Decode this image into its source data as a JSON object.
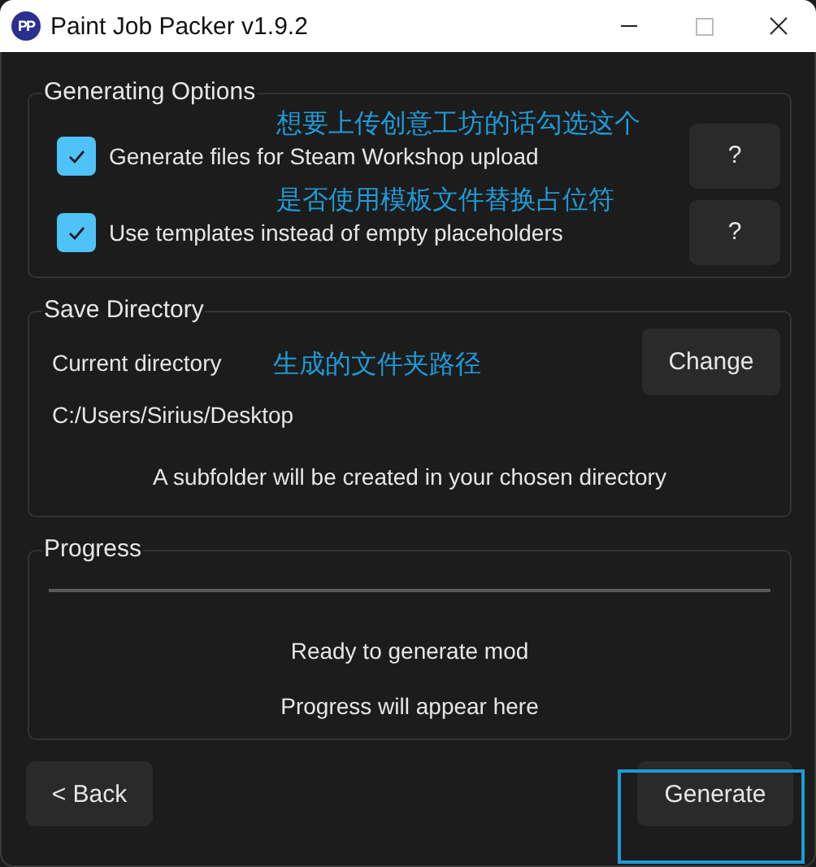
{
  "window": {
    "title": "Paint Job Packer v1.9.2",
    "logo": "PP"
  },
  "generating_options": {
    "title": "Generating Options",
    "options": [
      {
        "label": "Generate files for Steam Workshop upload",
        "checked": true,
        "help": "?"
      },
      {
        "label": "Use templates instead of empty placeholders",
        "checked": true,
        "help": "?"
      }
    ]
  },
  "save_directory": {
    "title": "Save Directory",
    "label": "Current directory",
    "button": "Change",
    "path": "C:/Users/Sirius/Desktop",
    "note": "A subfolder will be created in your chosen directory"
  },
  "progress": {
    "title": "Progress",
    "status": "Ready to generate mod",
    "detail": "Progress will appear here"
  },
  "buttons": {
    "back": "< Back",
    "generate": "Generate",
    "generate_highlighted": true
  },
  "annotations": [
    {
      "text": "想要上传创意工坊的话勾选这个"
    },
    {
      "text": "是否使用模板文件替换占位符"
    },
    {
      "text": "生成的文件夹路径"
    }
  ]
}
